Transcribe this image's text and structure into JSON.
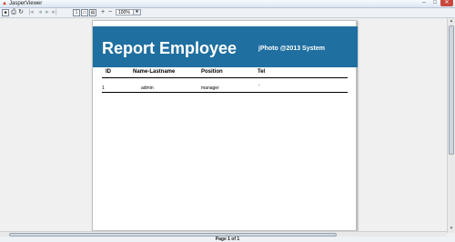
{
  "window": {
    "title": "JasperViewer",
    "app_icon": "jasper-icon",
    "minimize_glyph": "–",
    "maximize_glyph": "□",
    "close_glyph": "✕"
  },
  "toolbar": {
    "save_icon": "save-icon",
    "print_icon": "print-icon",
    "reload_icon": "reload-icon",
    "first_glyph": "|◂",
    "prev_glyph": "◂",
    "next_glyph": "▸",
    "last_glyph": "▸|",
    "actual_size_glyph": "1",
    "fit_page_glyph": "▭",
    "fit_width_glyph": "▤",
    "zoom_in_glyph": "+",
    "zoom_out_glyph": "−",
    "zoom_value": "100%",
    "zoom_arrow": "▾"
  },
  "report": {
    "title": "Report Employee",
    "subtitle": "jPhoto @2013 System",
    "header_color": "#1f6fa0",
    "columns": [
      "ID",
      "Name-Lastname",
      "Position",
      "Tel"
    ],
    "rows": [
      {
        "id": "1",
        "name": "admin",
        "position": "manager",
        "tel": "-"
      }
    ]
  },
  "status": {
    "page_label": "Page 1 of 1"
  }
}
